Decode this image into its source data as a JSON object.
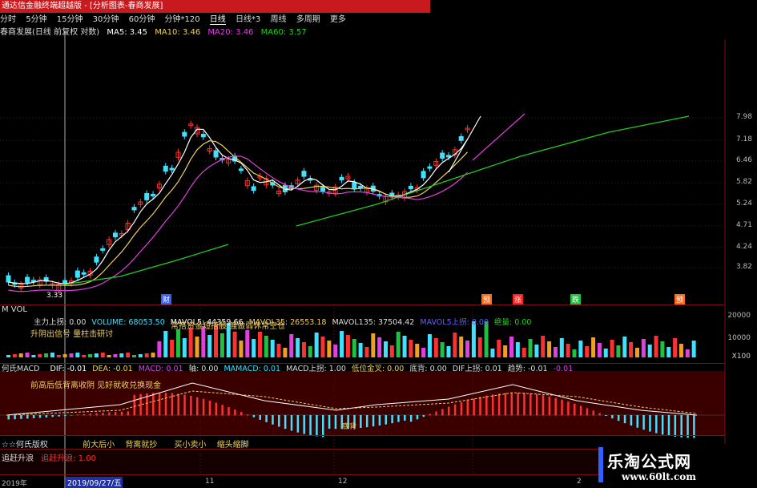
{
  "window": {
    "title": "通达信金融终端超越版 - [分析图表-春商发展]"
  },
  "menu": {
    "items": [
      "分时",
      "5分钟",
      "15分钟",
      "30分钟",
      "60分钟",
      "分钟*120",
      "日线",
      "日线*3",
      "周线",
      "多周期",
      "更多"
    ],
    "selected": "日线"
  },
  "main_panel": {
    "stock_label": "春商发展(日线 前复权 对数)",
    "ma5": "MA5: 3.45",
    "ma10": "MA10: 3.46",
    "ma20": "MA20: 3.46",
    "ma60": "MA60: 3.57",
    "price_axis": [
      "7.98",
      "7.18",
      "6.46",
      "5.82",
      "5.24",
      "4.71",
      "4.24",
      "3.82"
    ],
    "low_price": "3.33",
    "event_tags": [
      {
        "text": "财",
        "color": "#3060ff"
      },
      {
        "text": "预",
        "color": "#ff6a1a"
      },
      {
        "text": "涨",
        "color": "#ff2020"
      },
      {
        "text": "跌",
        "color": "#20c040"
      },
      {
        "text": "预",
        "color": "#ff6a1a"
      }
    ],
    "colors": {
      "ma5": "#ffffff",
      "ma10": "#f0d060",
      "ma20": "#e040e0",
      "ma60": "#20d020",
      "up": "#ff3030",
      "down": "#40e0ff"
    }
  },
  "vol_panel": {
    "title": "M VOL",
    "zhuli": "主力上拐: 0.00",
    "volume": "VOLUME: 68053.50",
    "mavol5": "MAVOL5: 44359.66",
    "mavol35": "MAVOL35: 26553.18",
    "mavol135": "MAVOL135: 37504.42",
    "mavol_up": "MAVOL5上拐: 0.00",
    "jiliang": "绝量: 0.00",
    "note1": "升阴出信号 量柱击研讨",
    "note2": "常搭资金短搭股 强做弱休常空仓",
    "axis": [
      "20000",
      "10000",
      "X100"
    ]
  },
  "macd_panel": {
    "title": "何氏MACD",
    "dif": "DIF: -0.01",
    "dea": "DEA: -0.01",
    "macd": "MACD: 0.01",
    "zhou": "轴: 0.00",
    "mamacd": "MAMACD: 0.01",
    "macd_up": "MACD上拐: 1.00",
    "diwei": "低位金叉: 0.00",
    "dibei": "底背: 0.00",
    "dif_up": "DIF上拐: 0.01",
    "qushi": "趋势: -0.01",
    "last": "-0.01",
    "note1": "前高后低背离收阴  见好就收兑换现金",
    "dibei_mark": "底背"
  },
  "hs_panel": {
    "title": "☆☆何氏版权",
    "notes": [
      "前大后小",
      "背离就抄",
      "买小卖小",
      "缩头缩脚"
    ]
  },
  "zs_panel": {
    "title": "追赶升浪",
    "value": "追赶升浪: 1.00"
  },
  "date_axis": {
    "year": "2019年",
    "cursor_date": "2019/09/27/五",
    "ticks": [
      "11",
      "12",
      "2"
    ]
  },
  "watermark": {
    "name": "乐淘公式网",
    "url": "www.60lt.com"
  }
}
